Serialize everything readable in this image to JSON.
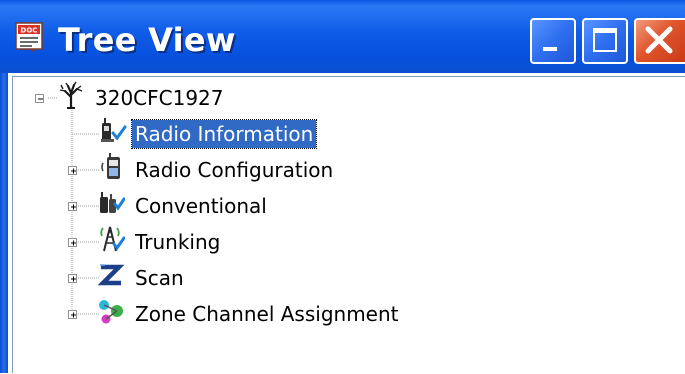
{
  "window": {
    "title": "Tree View",
    "app_icon": "doc-icon",
    "buttons": [
      "minimize-icon",
      "maximize-icon",
      "close-icon"
    ]
  },
  "tree": {
    "root": {
      "label": "320CFC1927",
      "icon": "tree-icon",
      "expanded": true
    },
    "children": [
      {
        "label": "Radio Information",
        "icon": "radio-info-icon",
        "expandable": false,
        "selected": true
      },
      {
        "label": "Radio Configuration",
        "icon": "radio-config-icon",
        "expandable": true,
        "selected": false
      },
      {
        "label": "Conventional",
        "icon": "conventional-icon",
        "expandable": true,
        "selected": false
      },
      {
        "label": "Trunking",
        "icon": "trunking-icon",
        "expandable": true,
        "selected": false
      },
      {
        "label": "Scan",
        "icon": "scan-icon",
        "expandable": true,
        "selected": false
      },
      {
        "label": "Zone Channel Assignment",
        "icon": "zone-channel-icon",
        "expandable": true,
        "selected": false
      }
    ]
  },
  "colors": {
    "titlebar": "#0a56e6",
    "close_button": "#e0552c",
    "selection": "#316ac5"
  }
}
